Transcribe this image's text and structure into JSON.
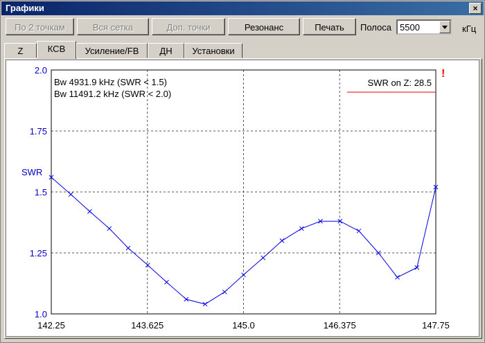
{
  "window": {
    "title": "Графики",
    "close_label": "×"
  },
  "toolbar": {
    "buttons": [
      {
        "label": "По 2 точкам",
        "enabled": false
      },
      {
        "label": "Вся сетка",
        "enabled": false
      },
      {
        "label": "Доп. точки",
        "enabled": false
      },
      {
        "label": "Резонанс",
        "enabled": true
      },
      {
        "label": "Печать",
        "enabled": true
      }
    ],
    "band_label": "Полоса",
    "band_value": "5500",
    "unit": "кГц"
  },
  "tabs": [
    {
      "label": "Z",
      "active": false
    },
    {
      "label": "КСВ",
      "active": true
    },
    {
      "label": "Усиление/FB",
      "active": false
    },
    {
      "label": "ДН",
      "active": false
    },
    {
      "label": "Установки",
      "active": false
    }
  ],
  "chart_data": {
    "type": "line",
    "ylabel": "SWR",
    "xlim": [
      142.25,
      147.75
    ],
    "ylim": [
      1.0,
      2.0
    ],
    "xticks": [
      "142.25",
      "143.625",
      "145.0",
      "146.375",
      "147.75"
    ],
    "yticks": [
      "2.0",
      "1.75",
      "1.5",
      "1.25",
      "1.0"
    ],
    "grid": true,
    "series_color": "#0000ee",
    "annotations": {
      "bw1": "Bw 4931.9 kHz (SWR < 1.5)",
      "bw2": "Bw 11491.2 kHz (SWR < 2.0)",
      "swr_on_z": "SWR on Z: 28.5",
      "warning": "!"
    },
    "series": [
      {
        "x": [
          142.25,
          142.53,
          142.8,
          143.08,
          143.35,
          143.63,
          143.9,
          144.18,
          144.45,
          144.73,
          145.0,
          145.28,
          145.55,
          145.83,
          146.1,
          146.38,
          146.65,
          146.93,
          147.2,
          147.48,
          147.75
        ],
        "y": [
          1.56,
          1.49,
          1.42,
          1.35,
          1.27,
          1.2,
          1.13,
          1.06,
          1.04,
          1.09,
          1.16,
          1.23,
          1.3,
          1.35,
          1.38,
          1.38,
          1.34,
          1.25,
          1.15,
          1.19,
          1.52
        ]
      }
    ]
  }
}
